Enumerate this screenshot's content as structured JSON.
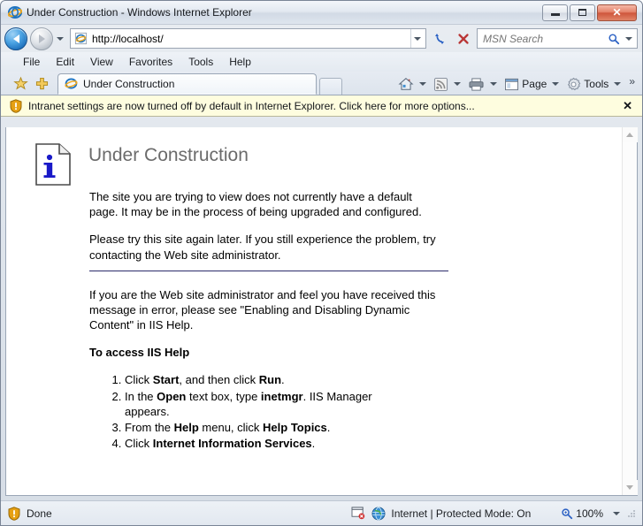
{
  "window": {
    "title": "Under Construction - Windows Internet Explorer",
    "minimize_label": "Minimize",
    "maximize_label": "Maximize",
    "close_label": "Close"
  },
  "navigation": {
    "back_label": "Back",
    "forward_label": "Forward",
    "history_label": "Recent Pages",
    "url": "http://localhost/",
    "address_dropdown_label": "Address dropdown",
    "refresh_label": "Refresh",
    "stop_label": "Stop"
  },
  "search": {
    "placeholder": "MSN Search",
    "go_label": "Search",
    "provider_dropdown_label": "Change search provider"
  },
  "menu": {
    "items": [
      {
        "label": "File"
      },
      {
        "label": "Edit"
      },
      {
        "label": "View"
      },
      {
        "label": "Favorites"
      },
      {
        "label": "Tools"
      },
      {
        "label": "Help"
      }
    ]
  },
  "favorites": {
    "center_label": "Favorites Center",
    "add_label": "Add to Favorites"
  },
  "tabs": {
    "items": [
      {
        "label": "Under Construction"
      }
    ],
    "new_tab_label": "New Tab"
  },
  "command_bar": {
    "home_label": "Home",
    "feeds_label": "Feeds",
    "print_label": "Print",
    "page_label": "Page",
    "tools_label": "Tools",
    "overflow_label": "»"
  },
  "information_bar": {
    "message": "Intranet settings are now turned off by default in Internet Explorer. Click here for more options...",
    "close_label": "✕",
    "background": "#fefddf"
  },
  "page": {
    "heading": "Under Construction",
    "heading_color": "#6b6b6b",
    "paragraph_1": "The site you are trying to view does not currently have a default page. It may be in the process of being upgraded and configured.",
    "paragraph_2": "Please try this site again later. If you still experience the problem, try contacting the Web site administrator.",
    "rule_color": "#2b2b6b",
    "paragraph_3": "If you are the Web site administrator and feel you have received this message in error, please see \"Enabling and Disabling Dynamic Content\" in IIS Help.",
    "access_heading": "To access IIS Help",
    "steps": [
      {
        "parts": [
          {
            "text": "Click ",
            "bold": false
          },
          {
            "text": "Start",
            "bold": true
          },
          {
            "text": ", and then click ",
            "bold": false
          },
          {
            "text": "Run",
            "bold": true
          },
          {
            "text": ".",
            "bold": false
          }
        ]
      },
      {
        "parts": [
          {
            "text": "In the ",
            "bold": false
          },
          {
            "text": "Open",
            "bold": true
          },
          {
            "text": " text box, type ",
            "bold": false
          },
          {
            "text": "inetmgr",
            "bold": true
          },
          {
            "text": ". IIS Manager appears.",
            "bold": false
          }
        ]
      },
      {
        "parts": [
          {
            "text": "From the ",
            "bold": false
          },
          {
            "text": "Help",
            "bold": true
          },
          {
            "text": " menu, click ",
            "bold": false
          },
          {
            "text": "Help Topics",
            "bold": true
          },
          {
            "text": ".",
            "bold": false
          }
        ]
      },
      {
        "parts": [
          {
            "text": "Click ",
            "bold": false
          },
          {
            "text": "Internet Information Services",
            "bold": true
          },
          {
            "text": ".",
            "bold": false
          }
        ]
      }
    ]
  },
  "scrollbar": {
    "up_label": "Scroll up",
    "down_label": "Scroll down"
  },
  "status_bar": {
    "status": "Done",
    "popup_blocked_label": "Pop-up blocked",
    "zone": "Internet | Protected Mode: On",
    "zoom": "100%",
    "zoom_dropdown_label": "Change zoom level"
  }
}
